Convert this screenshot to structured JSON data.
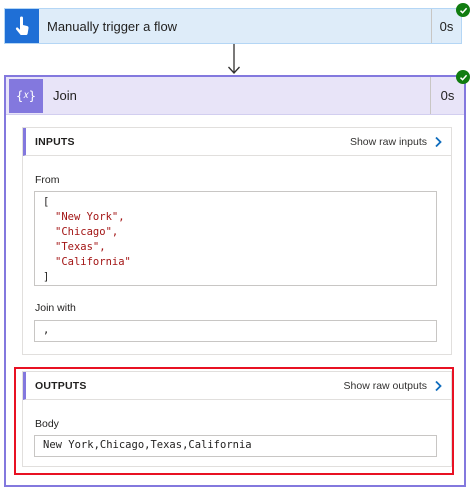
{
  "trigger": {
    "title": "Manually trigger a flow",
    "duration": "0s",
    "icon": "hand-tap-icon",
    "status": "succeeded"
  },
  "join": {
    "title": "Join",
    "duration": "0s",
    "icon": "variable-braces-icon",
    "status": "succeeded",
    "inputs": {
      "header": "INPUTS",
      "raw_link": "Show raw inputs",
      "from_label": "From",
      "from_open": "[",
      "from_items": [
        "\"New York\",",
        "\"Chicago\",",
        "\"Texas\",",
        "\"California\""
      ],
      "from_close": "]",
      "join_with_label": "Join with",
      "join_with_value": ","
    },
    "outputs": {
      "header": "OUTPUTS",
      "raw_link": "Show raw outputs",
      "body_label": "Body",
      "body_value": "New York,Chicago,Texas,California"
    }
  },
  "colors": {
    "trigger_accent": "#1f6fd6",
    "action_accent": "#8378de",
    "success": "#107c10",
    "highlight": "#e81123",
    "string": "#a31515"
  }
}
